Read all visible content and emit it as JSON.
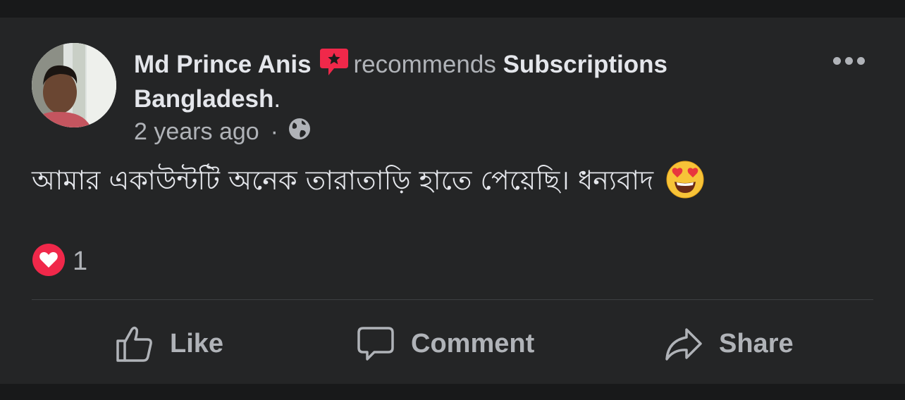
{
  "post": {
    "author_name": "Md Prince Anis",
    "verb": "recommends",
    "page_name": "Subscriptions Bangladesh",
    "page_suffix": ".",
    "timestamp": "2 years ago",
    "separator": "·",
    "privacy_icon": "globe-icon",
    "text": "আমার একাউন্টটি অনেক তারাতাড়ি হাতে পেয়েছি।  ধন্যবাদ",
    "emoji": "heart-eyes-emoji",
    "reaction_icon": "love-reaction-icon",
    "reaction_count": "1"
  },
  "actions": {
    "like_label": "Like",
    "comment_label": "Comment",
    "share_label": "Share"
  },
  "colors": {
    "background": "#18191a",
    "card": "#242526",
    "recommend_red": "#f0284a",
    "text_primary": "#e4e6eb",
    "text_secondary": "#b0b3b8"
  }
}
